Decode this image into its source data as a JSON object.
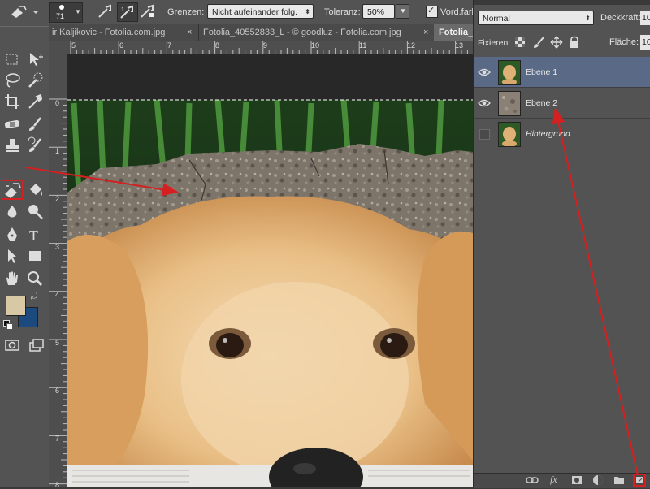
{
  "options_bar": {
    "brush_size": "71",
    "limits_label": "Grenzen:",
    "limits_value": "Nicht aufeinander folg.",
    "tolerance_label": "Toleranz:",
    "tolerance_value": "50%",
    "foreground_label": "Vord.farb"
  },
  "tabs": [
    {
      "label": "ir Kaljikovic - Fotolia.com.jpg",
      "close": "×"
    },
    {
      "label": "Fotolia_40552833_L - © goodluz - Fotolia.com.jpg",
      "close": "×"
    },
    {
      "label": "Fotolia_",
      "active": true
    }
  ],
  "ruler_top": [
    "5",
    "6",
    "7",
    "8",
    "9",
    "10",
    "11",
    "12",
    "13"
  ],
  "ruler_left": [
    "0",
    "1",
    "2",
    "3",
    "4",
    "5",
    "6",
    "7",
    "8"
  ],
  "colors": {
    "foreground": "#d9c8a6",
    "background": "#1c4a7e",
    "annotation": "#d42020"
  },
  "layers_panel": {
    "blend_mode": "Normal",
    "opacity_label": "Deckkraft:",
    "opacity_value": "10",
    "lock_label": "Fixieren:",
    "fill_label": "Fläche:",
    "fill_value": "10",
    "layers": [
      {
        "name": "Ebene 1",
        "visible": true,
        "selected": true
      },
      {
        "name": "Ebene 2",
        "visible": true,
        "selected": false
      },
      {
        "name": "Hintergrund",
        "visible": false,
        "selected": false
      }
    ]
  }
}
